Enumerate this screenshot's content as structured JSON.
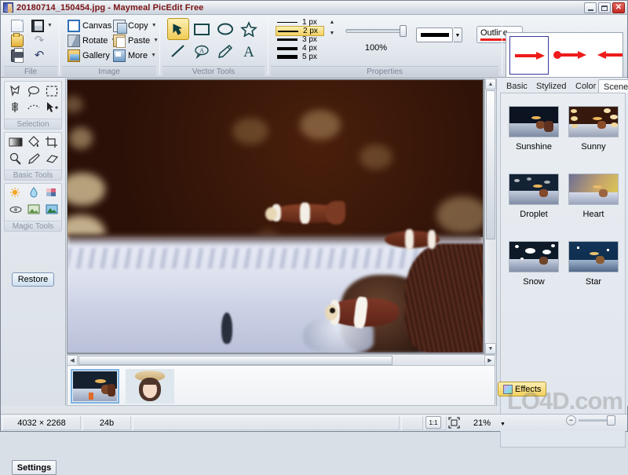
{
  "window": {
    "title": "20180714_150454.jpg - Maymeal PicEdit Free",
    "app_icon": "app-icon",
    "minimize_label": "",
    "maximize_label": "",
    "close_label": "✕"
  },
  "ribbon": {
    "groups": [
      {
        "label": "File",
        "items": [
          {
            "label": "",
            "icon": "new-document-icon"
          },
          {
            "label": "",
            "icon": "save-icon",
            "has_dropdown": true
          },
          {
            "label": "",
            "icon": "open-folder-icon"
          },
          {
            "label": "",
            "icon": "redo-icon"
          },
          {
            "label": "",
            "icon": "print-icon"
          },
          {
            "label": "",
            "icon": "undo-icon"
          }
        ]
      },
      {
        "label": "Image",
        "items": [
          {
            "label": "Canvas",
            "icon": "canvas-icon"
          },
          {
            "label": "Copy",
            "icon": "copy-icon",
            "has_dropdown": true
          },
          {
            "label": "Rotate",
            "icon": "rotate-icon",
            "has_dropdown": true
          },
          {
            "label": "Paste",
            "icon": "paste-icon",
            "has_dropdown": true
          },
          {
            "label": "Gallery",
            "icon": "gallery-icon"
          },
          {
            "label": "More",
            "icon": "more-icon",
            "has_dropdown": true
          }
        ]
      },
      {
        "label": "Vector Tools",
        "tools": [
          {
            "name": "arrow-tool",
            "selected": true
          },
          {
            "name": "rectangle-tool",
            "selected": false
          },
          {
            "name": "ellipse-tool",
            "selected": false
          },
          {
            "name": "star-tool",
            "selected": false
          },
          {
            "name": "line-tool",
            "selected": false
          },
          {
            "name": "callout-tool",
            "selected": false
          },
          {
            "name": "pencil-tool",
            "selected": false
          },
          {
            "name": "text-tool",
            "selected": false
          }
        ]
      },
      {
        "label": "Properties",
        "stroke_widths": [
          {
            "label": "1 px",
            "thickness": 1,
            "selected": false
          },
          {
            "label": "2 px",
            "thickness": 2,
            "selected": true
          },
          {
            "label": "3 px",
            "thickness": 3,
            "selected": false
          },
          {
            "label": "4 px",
            "thickness": 4,
            "selected": false
          },
          {
            "label": "5 px",
            "thickness": 5,
            "selected": false
          }
        ],
        "opacity_value": "100%",
        "color_swatch": "#000000",
        "outline_label": "Outline",
        "outline_underline_color": "#ee1b1b"
      }
    ],
    "arrow_gallery": {
      "color": "#ee1b1b",
      "styles": [
        {
          "name": "arrow-plain-right",
          "selected": true
        },
        {
          "name": "arrow-dot-right",
          "selected": false
        },
        {
          "name": "arrow-plain-left",
          "selected": false
        }
      ]
    }
  },
  "left_toolbox": {
    "groups": [
      {
        "label": "Selection",
        "tools": [
          "polygon-select-icon",
          "lasso-select-icon",
          "rectangle-select-icon",
          "magnetic-select-icon",
          "freehand-select-icon",
          "move-select-icon"
        ]
      },
      {
        "label": "Basic Tools",
        "tools": [
          "gradient-icon",
          "paint-bucket-icon",
          "crop-icon",
          "zoom-icon",
          "eyedropper-icon",
          "eraser-icon"
        ]
      },
      {
        "label": "Magic Tools",
        "tools": [
          "brightness-icon",
          "blur-icon",
          "saturation-icon",
          "red-eye-icon",
          "clone-icon",
          "enhance-icon"
        ]
      }
    ],
    "restore_label": "Restore",
    "settings_label": "Settings"
  },
  "right_panel": {
    "tabs": [
      {
        "label": "Basic",
        "active": false
      },
      {
        "label": "Stylized",
        "active": false
      },
      {
        "label": "Color",
        "active": false
      },
      {
        "label": "Scene",
        "active": true
      }
    ],
    "effects": [
      {
        "label": "Sunshine"
      },
      {
        "label": "Sunny"
      },
      {
        "label": "Droplet"
      },
      {
        "label": "Heart"
      },
      {
        "label": "Snow"
      },
      {
        "label": "Star"
      }
    ],
    "effects_button_label": "Effects"
  },
  "filmstrip": {
    "thumbnails": [
      {
        "name": "thumbnail-fish",
        "selected": true
      },
      {
        "name": "thumbnail-portrait",
        "selected": false
      }
    ]
  },
  "statusbar": {
    "dimensions": "4032 × 2268",
    "color_depth": "24b",
    "actual_size_label": "1:1",
    "fit_screen_label": "fit-icon",
    "zoom_level": "21%",
    "zoom_out_label": "−",
    "zoom_in_label": "+"
  },
  "watermark": "LO4D.com"
}
